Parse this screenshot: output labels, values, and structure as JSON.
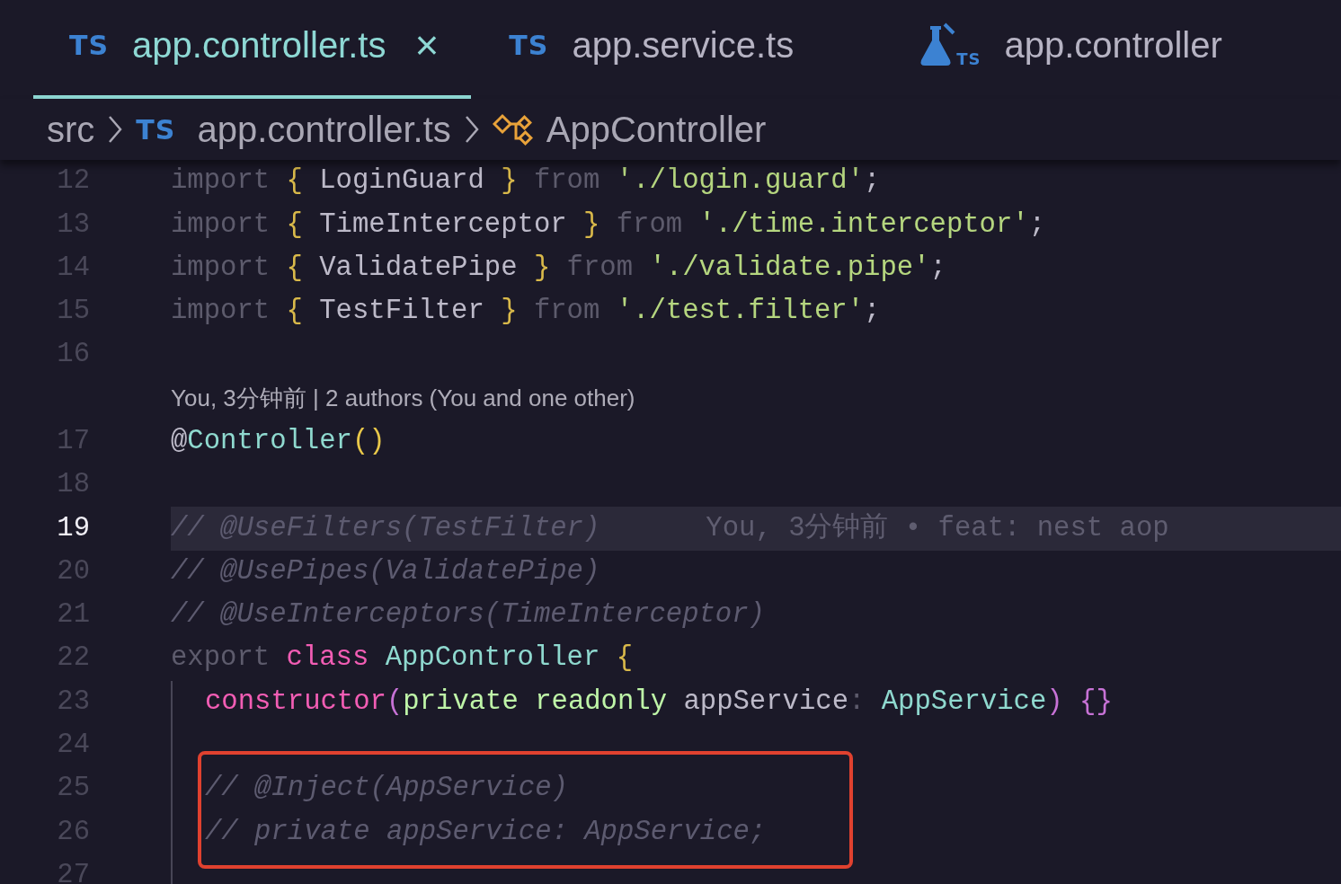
{
  "tabs": [
    {
      "kind": "ts",
      "badge": "TS",
      "label": "app.controller.ts",
      "selected": true,
      "close": "×"
    },
    {
      "kind": "ts",
      "badge": "TS",
      "label": "app.service.ts",
      "selected": false
    },
    {
      "kind": "test",
      "badge": "TS",
      "label": "app.controller",
      "selected": false
    }
  ],
  "breadcrumb": [
    {
      "kind": "folder",
      "label": "src"
    },
    {
      "kind": "ts",
      "badge": "TS",
      "label": "app.controller.ts"
    },
    {
      "kind": "class",
      "label": "AppController"
    }
  ],
  "lines": [
    {
      "number": "12",
      "current": false,
      "indented": false,
      "boxed": false,
      "tokens": [
        {
          "kind": "kw-dim",
          "text": "import "
        },
        {
          "kind": "brace",
          "text": "{"
        },
        {
          "kind": "name",
          "text": " LoginGuard "
        },
        {
          "kind": "brace",
          "text": "}"
        },
        {
          "kind": "kw-dim",
          "text": " from "
        },
        {
          "kind": "string",
          "text": "'./login.guard'"
        },
        {
          "kind": "name",
          "text": ";"
        }
      ]
    },
    {
      "number": "13",
      "current": false,
      "indented": false,
      "boxed": false,
      "tokens": [
        {
          "kind": "kw-dim",
          "text": "import "
        },
        {
          "kind": "brace",
          "text": "{"
        },
        {
          "kind": "name",
          "text": " TimeInterceptor "
        },
        {
          "kind": "brace",
          "text": "}"
        },
        {
          "kind": "kw-dim",
          "text": " from "
        },
        {
          "kind": "string",
          "text": "'./time.interceptor'"
        },
        {
          "kind": "name",
          "text": ";"
        }
      ]
    },
    {
      "number": "14",
      "current": false,
      "indented": false,
      "boxed": false,
      "tokens": [
        {
          "kind": "kw-dim",
          "text": "import "
        },
        {
          "kind": "brace",
          "text": "{"
        },
        {
          "kind": "name",
          "text": " ValidatePipe "
        },
        {
          "kind": "brace",
          "text": "}"
        },
        {
          "kind": "kw-dim",
          "text": " from "
        },
        {
          "kind": "string",
          "text": "'./validate.pipe'"
        },
        {
          "kind": "name",
          "text": ";"
        }
      ]
    },
    {
      "number": "15",
      "current": false,
      "indented": false,
      "boxed": false,
      "tokens": [
        {
          "kind": "kw-dim",
          "text": "import "
        },
        {
          "kind": "brace",
          "text": "{"
        },
        {
          "kind": "name",
          "text": " TestFilter "
        },
        {
          "kind": "brace",
          "text": "}"
        },
        {
          "kind": "kw-dim",
          "text": " from "
        },
        {
          "kind": "string",
          "text": "'./test.filter'"
        },
        {
          "kind": "name",
          "text": ";"
        }
      ]
    },
    {
      "number": "16",
      "current": false,
      "indented": false,
      "boxed": false
    },
    {
      "number": "17",
      "current": false,
      "indented": false,
      "boxed": false,
      "codelens": "You, 3分钟前 | 2 authors (You and one other)",
      "tokens": [
        {
          "kind": "name",
          "text": "@"
        },
        {
          "kind": "type",
          "text": "Controller"
        },
        {
          "kind": "paren",
          "text": "()"
        }
      ]
    },
    {
      "number": "18",
      "current": false,
      "indented": false,
      "boxed": false
    },
    {
      "number": "19",
      "current": true,
      "indented": false,
      "boxed": false,
      "blame": "You, 3分钟前 • feat: nest aop",
      "tokens": [
        {
          "kind": "comment",
          "text": "// @UseFilters(TestFilter)"
        }
      ]
    },
    {
      "number": "20",
      "current": false,
      "indented": false,
      "boxed": false,
      "tokens": [
        {
          "kind": "comment",
          "text": "// @UsePipes(ValidatePipe)"
        }
      ]
    },
    {
      "number": "21",
      "current": false,
      "indented": false,
      "boxed": false,
      "tokens": [
        {
          "kind": "comment",
          "text": "// @UseInterceptors(TimeInterceptor)"
        }
      ]
    },
    {
      "number": "22",
      "current": false,
      "indented": false,
      "boxed": false,
      "tokens": [
        {
          "kind": "kw-dim",
          "text": "export "
        },
        {
          "kind": "kw-pink",
          "text": "class "
        },
        {
          "kind": "type",
          "text": "AppController "
        },
        {
          "kind": "brace",
          "text": "{"
        }
      ]
    },
    {
      "number": "23",
      "current": false,
      "indented": true,
      "boxed": false,
      "tokens": [
        {
          "kind": "kw-pink",
          "text": "constructor"
        },
        {
          "kind": "paren2",
          "text": "("
        },
        {
          "kind": "kw-green",
          "text": "private readonly"
        },
        {
          "kind": "name",
          "text": " appService"
        },
        {
          "kind": "punct",
          "text": ": "
        },
        {
          "kind": "type",
          "text": "AppService"
        },
        {
          "kind": "paren2",
          "text": ") {}"
        }
      ]
    },
    {
      "number": "24",
      "current": false,
      "indented": true,
      "boxed": false
    },
    {
      "number": "25",
      "current": false,
      "indented": true,
      "boxed": true,
      "tokens": [
        {
          "kind": "comment",
          "text": "// @Inject(AppService)"
        }
      ]
    },
    {
      "number": "26",
      "current": false,
      "indented": true,
      "boxed": true,
      "tokens": [
        {
          "kind": "comment",
          "text": "// private appService: AppService;"
        }
      ]
    },
    {
      "number": "27",
      "current": false,
      "indented": true,
      "boxed": false
    }
  ],
  "annotation": {
    "color": "#e0412f"
  }
}
